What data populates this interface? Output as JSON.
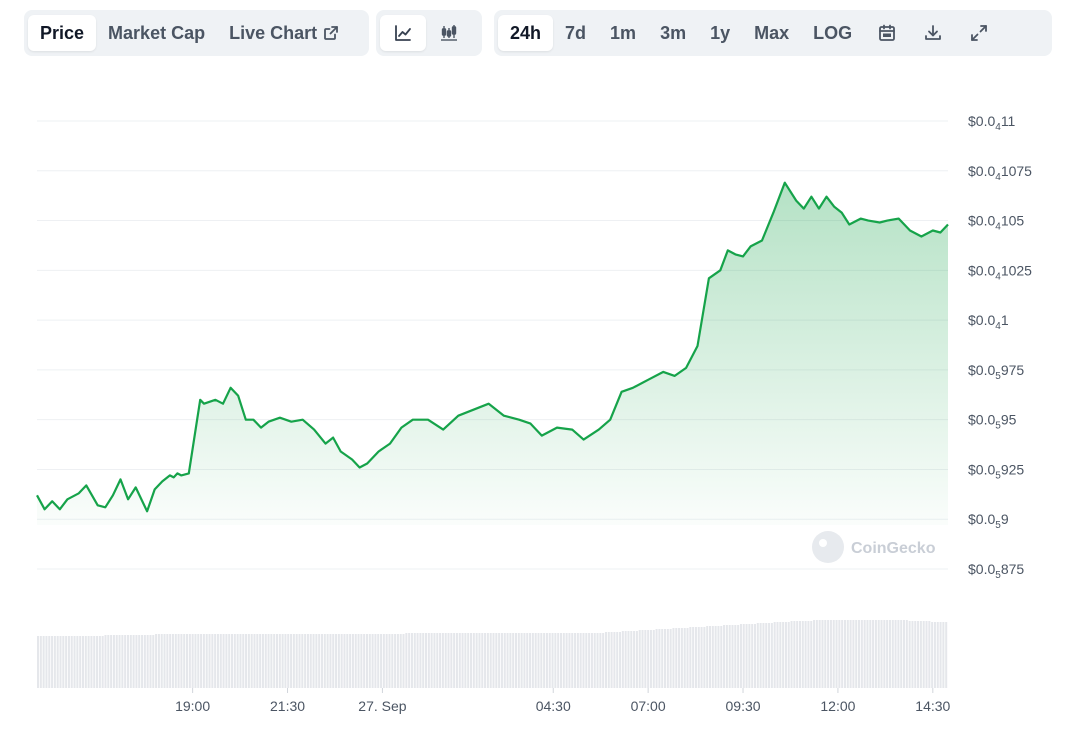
{
  "toolbar": {
    "tabs": [
      {
        "label": "Price",
        "active": true
      },
      {
        "label": "Market Cap",
        "active": false
      },
      {
        "label": "Live Chart",
        "active": false
      }
    ],
    "chart_types": [
      {
        "icon": "line-chart-icon",
        "active": true
      },
      {
        "icon": "candlestick-chart-icon",
        "active": false
      }
    ],
    "ranges": [
      {
        "label": "24h",
        "active": true
      },
      {
        "label": "7d",
        "active": false
      },
      {
        "label": "1m",
        "active": false
      },
      {
        "label": "3m",
        "active": false
      },
      {
        "label": "1y",
        "active": false
      },
      {
        "label": "Max",
        "active": false
      },
      {
        "label": "LOG",
        "active": false
      }
    ],
    "tools": [
      "calendar-icon",
      "download-icon",
      "fullscreen-icon"
    ]
  },
  "watermark": "CoinGecko",
  "colors": {
    "line": "#16a34a",
    "fill": "#16a34a",
    "volume": "#e5e7eb",
    "grid": "#eef0f3"
  },
  "chart_data": {
    "type": "area",
    "title": "",
    "xlabel": "",
    "ylabel": "",
    "ylim": [
      9.87e-06,
      1.12e-05
    ],
    "grid": true,
    "y_ticks": [
      {
        "value": 1.1e-05,
        "pre": "$0.0",
        "sub": "4",
        "post": "11"
      },
      {
        "value": 1.075e-05,
        "pre": "$0.0",
        "sub": "4",
        "post": "1075"
      },
      {
        "value": 1.05e-05,
        "pre": "$0.0",
        "sub": "4",
        "post": "105"
      },
      {
        "value": 1.025e-05,
        "pre": "$0.0",
        "sub": "4",
        "post": "1025"
      },
      {
        "value": 1e-05,
        "pre": "$0.0",
        "sub": "4",
        "post": "1"
      },
      {
        "value": 9.75e-06,
        "pre": "$0.0",
        "sub": "5",
        "post": "975"
      },
      {
        "value": 9.5e-06,
        "pre": "$0.0",
        "sub": "5",
        "post": "95"
      },
      {
        "value": 9.25e-06,
        "pre": "$0.0",
        "sub": "5",
        "post": "925"
      },
      {
        "value": 9e-06,
        "pre": "$0.0",
        "sub": "5",
        "post": "9"
      },
      {
        "value": 8.75e-06,
        "pre": "$0.0",
        "sub": "5",
        "post": "875"
      }
    ],
    "x_ticks": [
      {
        "label": "19:00",
        "t": 2.0
      },
      {
        "label": "21:30",
        "t": 4.5
      },
      {
        "label": "27. Sep",
        "t": 7.0
      },
      {
        "label": "04:30",
        "t": 11.5
      },
      {
        "label": "07:00",
        "t": 14.0
      },
      {
        "label": "09:30",
        "t": 16.5
      },
      {
        "label": "12:00",
        "t": 19.0
      },
      {
        "label": "14:30",
        "t": 21.5
      }
    ],
    "x_range": [
      -2.1,
      21.9
    ],
    "series": [
      {
        "x": [
          -2.1,
          -1.9,
          -1.7,
          -1.5,
          -1.3,
          -1.0,
          -0.8,
          -0.5,
          -0.3,
          -0.1,
          0.1,
          0.3,
          0.5,
          0.8,
          1.0,
          1.2,
          1.4,
          1.5,
          1.6,
          1.7,
          1.9,
          2.2,
          2.3,
          2.6,
          2.8,
          3.0,
          3.2,
          3.4,
          3.6,
          3.8,
          4.0,
          4.3,
          4.6,
          4.9,
          5.2,
          5.5,
          5.7,
          5.9,
          6.2,
          6.4,
          6.6,
          6.9,
          7.2,
          7.5,
          7.8,
          8.2,
          8.6,
          9.0,
          9.4,
          9.8,
          10.2,
          10.6,
          10.9,
          11.2,
          11.6,
          12.0,
          12.3,
          12.7,
          13.0,
          13.3,
          13.6,
          14.0,
          14.4,
          14.7,
          15.0,
          15.3,
          15.6,
          15.9,
          16.1,
          16.3,
          16.5,
          16.7,
          17.0,
          17.3,
          17.6,
          17.9,
          18.1,
          18.3,
          18.5,
          18.7,
          18.9,
          19.1,
          19.3,
          19.6,
          19.8,
          20.1,
          20.3,
          20.6,
          20.9,
          21.2,
          21.5,
          21.7,
          21.9
        ],
        "y": [
          9.12e-06,
          9.05e-06,
          9.09e-06,
          9.05e-06,
          9.1e-06,
          9.13e-06,
          9.17e-06,
          9.07e-06,
          9.06e-06,
          9.12e-06,
          9.2e-06,
          9.1e-06,
          9.16e-06,
          9.04e-06,
          9.15e-06,
          9.19e-06,
          9.22e-06,
          9.21e-06,
          9.23e-06,
          9.22e-06,
          9.23e-06,
          9.6e-06,
          9.58e-06,
          9.6e-06,
          9.58e-06,
          9.66e-06,
          9.62e-06,
          9.5e-06,
          9.5e-06,
          9.46e-06,
          9.49e-06,
          9.51e-06,
          9.49e-06,
          9.5e-06,
          9.45e-06,
          9.38e-06,
          9.41e-06,
          9.34e-06,
          9.3e-06,
          9.26e-06,
          9.28e-06,
          9.34e-06,
          9.38e-06,
          9.46e-06,
          9.5e-06,
          9.5e-06,
          9.45e-06,
          9.52e-06,
          9.55e-06,
          9.58e-06,
          9.52e-06,
          9.5e-06,
          9.48e-06,
          9.42e-06,
          9.46e-06,
          9.45e-06,
          9.4e-06,
          9.45e-06,
          9.5e-06,
          9.64e-06,
          9.66e-06,
          9.7e-06,
          9.74e-06,
          9.72e-06,
          9.76e-06,
          9.87e-06,
          1.021e-05,
          1.025e-05,
          1.035e-05,
          1.033e-05,
          1.032e-05,
          1.037e-05,
          1.04e-05,
          1.054e-05,
          1.069e-05,
          1.06e-05,
          1.056e-05,
          1.062e-05,
          1.056e-05,
          1.062e-05,
          1.057e-05,
          1.054e-05,
          1.048e-05,
          1.051e-05,
          1.05e-05,
          1.049e-05,
          1.05e-05,
          1.051e-05,
          1.045e-05,
          1.042e-05,
          1.045e-05,
          1.044e-05,
          1.048e-05
        ]
      }
    ],
    "volume": {
      "x_start": -2.1,
      "x_end": 21.9,
      "values": [
        52,
        52,
        52,
        52,
        52,
        52,
        52,
        52,
        52,
        52,
        52,
        52,
        52,
        52,
        52,
        52,
        52,
        52,
        52,
        52,
        52,
        52,
        52,
        52,
        53,
        53,
        53,
        53,
        53,
        53,
        53,
        53,
        53,
        53,
        53,
        53,
        53,
        53,
        53,
        53,
        53,
        53,
        54,
        54,
        54,
        54,
        54,
        54,
        54,
        54,
        54,
        54,
        54,
        54,
        54,
        54,
        54,
        54,
        54,
        54,
        54,
        54,
        54,
        54,
        54,
        54,
        54,
        54,
        54,
        54,
        54,
        54,
        54,
        54,
        54,
        54,
        54,
        54,
        54,
        54,
        54,
        54,
        54,
        54,
        54,
        54,
        54,
        54,
        54,
        54,
        54,
        54,
        54,
        54,
        54,
        54,
        54,
        54,
        54,
        54,
        54,
        54,
        54,
        54,
        54,
        54,
        54,
        54,
        54,
        54,
        54,
        54,
        54,
        54,
        54,
        54,
        54,
        54,
        54,
        54,
        54,
        54,
        54,
        54,
        54,
        54,
        54,
        54,
        54,
        54,
        54,
        55,
        55,
        55,
        55,
        55,
        55,
        55,
        55,
        55,
        55,
        55,
        55,
        55,
        55,
        55,
        55,
        55,
        55,
        55,
        55,
        55,
        55,
        55,
        55,
        55,
        55,
        55,
        55,
        55,
        55,
        55,
        55,
        55,
        55,
        55,
        55,
        55,
        55,
        55,
        55,
        55,
        55,
        55,
        55,
        55,
        55,
        55,
        55,
        55,
        55,
        55,
        55,
        55,
        55,
        55,
        55,
        55,
        55,
        55,
        55,
        55,
        55,
        55,
        55,
        55,
        55,
        55,
        55,
        55,
        55,
        55,
        56,
        56,
        56,
        56,
        56,
        56,
        57,
        57,
        57,
        57,
        57,
        57,
        58,
        58,
        58,
        58,
        58,
        58,
        59,
        59,
        59,
        59,
        59,
        59,
        60,
        60,
        60,
        60,
        60,
        60,
        61,
        61,
        61,
        61,
        61,
        61,
        62,
        62,
        62,
        62,
        62,
        62,
        63,
        63,
        63,
        63,
        63,
        63,
        64,
        64,
        64,
        64,
        64,
        64,
        65,
        65,
        65,
        65,
        65,
        65,
        66,
        66,
        66,
        66,
        66,
        66,
        67,
        67,
        67,
        67,
        67,
        67,
        67,
        67,
        68,
        68,
        68,
        68,
        68,
        68,
        68,
        68,
        68,
        68,
        68,
        68,
        68,
        68,
        68,
        68,
        68,
        68,
        68,
        68,
        68,
        68,
        68,
        68,
        68,
        68,
        68,
        68,
        68,
        68,
        68,
        68,
        68,
        68,
        67,
        67,
        67,
        67,
        67,
        67,
        67,
        67,
        66,
        66,
        66,
        66,
        66,
        66
      ]
    }
  }
}
